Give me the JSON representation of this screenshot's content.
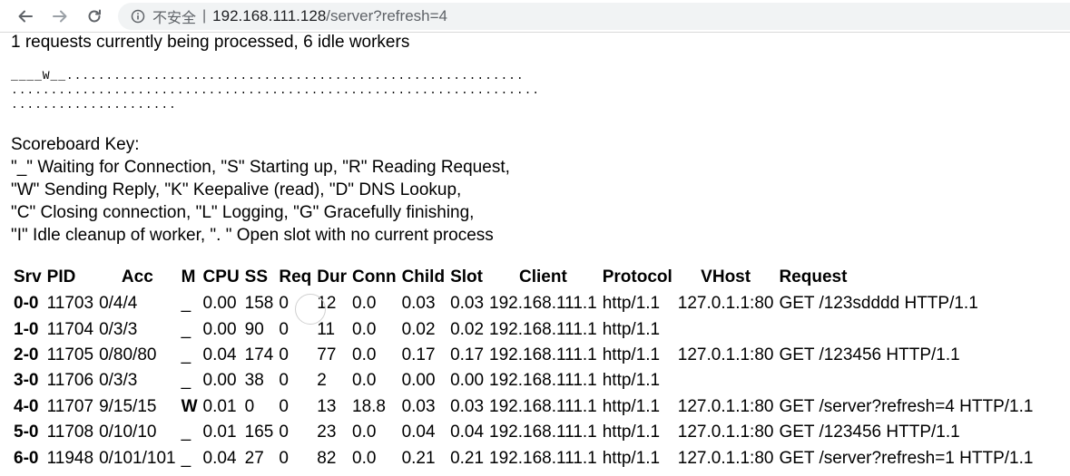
{
  "browser": {
    "insecure_label": "不安全",
    "separator": "|",
    "url_host": "192.168.111.128",
    "url_path": "/server?refresh=4"
  },
  "status": {
    "summary": "1 requests currently being processed, 6 idle workers",
    "scoreboard_lines": [
      "____W__..........................................................",
      "...................................................................",
      "....................."
    ]
  },
  "scoreboard_key": {
    "title": "Scoreboard Key:",
    "lines": [
      "\"_\" Waiting for Connection, \"S\" Starting up, \"R\" Reading Request,",
      "\"W\" Sending Reply, \"K\" Keepalive (read), \"D\" DNS Lookup,",
      "\"C\" Closing connection, \"L\" Logging, \"G\" Gracefully finishing,",
      "\"I\" Idle cleanup of worker, \". \" Open slot with no current process"
    ]
  },
  "table": {
    "headers": [
      "Srv",
      "PID",
      "Acc",
      "M",
      "CPU",
      "SS",
      "Req",
      "Dur",
      "Conn",
      "Child",
      "Slot",
      "Client",
      "Protocol",
      "VHost",
      "Request"
    ],
    "rows": [
      [
        "0-0",
        "11703",
        "0/4/4",
        "_",
        "0.00",
        "158",
        "0",
        "12",
        "0.0",
        "0.03",
        "0.03",
        "192.168.111.1",
        "http/1.1",
        "127.0.1.1:80",
        "GET /123sdddd HTTP/1.1"
      ],
      [
        "1-0",
        "11704",
        "0/3/3",
        "_",
        "0.00",
        "90",
        "0",
        "11",
        "0.0",
        "0.02",
        "0.02",
        "192.168.111.1",
        "http/1.1",
        "",
        ""
      ],
      [
        "2-0",
        "11705",
        "0/80/80",
        "_",
        "0.04",
        "174",
        "0",
        "77",
        "0.0",
        "0.17",
        "0.17",
        "192.168.111.1",
        "http/1.1",
        "127.0.1.1:80",
        "GET /123456 HTTP/1.1"
      ],
      [
        "3-0",
        "11706",
        "0/3/3",
        "_",
        "0.00",
        "38",
        "0",
        "2",
        "0.0",
        "0.00",
        "0.00",
        "192.168.111.1",
        "http/1.1",
        "",
        ""
      ],
      [
        "4-0",
        "11707",
        "9/15/15",
        "W",
        "0.01",
        "0",
        "0",
        "13",
        "18.8",
        "0.03",
        "0.03",
        "192.168.111.1",
        "http/1.1",
        "127.0.1.1:80",
        "GET /server?refresh=4 HTTP/1.1"
      ],
      [
        "5-0",
        "11708",
        "0/10/10",
        "_",
        "0.01",
        "165",
        "0",
        "23",
        "0.0",
        "0.04",
        "0.04",
        "192.168.111.1",
        "http/1.1",
        "127.0.1.1:80",
        "GET /123456 HTTP/1.1"
      ],
      [
        "6-0",
        "11948",
        "0/101/101",
        "_",
        "0.04",
        "27",
        "0",
        "82",
        "0.0",
        "0.21",
        "0.21",
        "192.168.111.1",
        "http/1.1",
        "127.0.1.1:80",
        "GET /server?refresh=1 HTTP/1.1"
      ]
    ]
  },
  "icons": {
    "back": "arrow-left-icon",
    "forward": "arrow-right-icon",
    "reload": "reload-icon",
    "info": "info-icon"
  },
  "colors": {
    "chrome_bg": "#ffffff",
    "omnibox_bg": "#f1f3f4",
    "icon_gray": "#5f6368"
  }
}
